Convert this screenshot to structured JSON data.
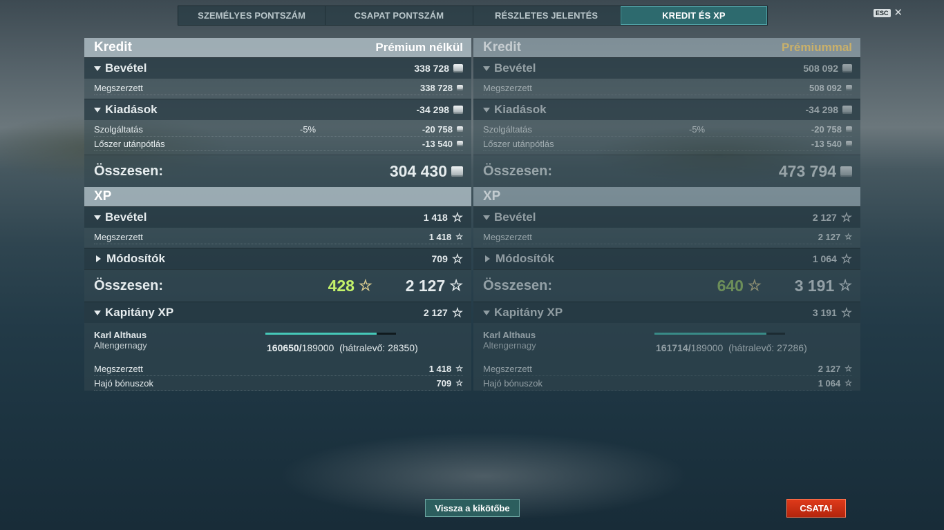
{
  "tabs": [
    "SZEMÉLYES PONTSZÁM",
    "CSAPAT PONTSZÁM",
    "RÉSZLETES JELENTÉS",
    "KREDIT ÉS XP"
  ],
  "esc_label": "ESC",
  "left": {
    "credit_title": "Kredit",
    "credit_mode": "Prémium nélkül",
    "income_label": "Bevétel",
    "income_value": "338 728",
    "earned_label": "Megszerzett",
    "earned_value": "338 728",
    "expenses_label": "Kiadások",
    "expenses_value": "-34 298",
    "service_label": "Szolgáltatás",
    "service_pct": "-5%",
    "service_value": "-20 758",
    "ammo_label": "Lőszer utánpótlás",
    "ammo_value": "-13 540",
    "total_label": "Összesen:",
    "credit_total": "304 430",
    "xp_title": "XP",
    "xp_income_label": "Bevétel",
    "xp_income_value": "1 418",
    "xp_earned_label": "Megszerzett",
    "xp_earned_value": "1 418",
    "modifiers_label": "Módosítók",
    "modifiers_value": "709",
    "xp_bonus": "428",
    "xp_total": "2 127",
    "captain_label": "Kapitány XP",
    "captain_value": "2 127",
    "captain_name": "Karl Althaus",
    "captain_rank": "Altengernagy",
    "progress_current": "160650/",
    "progress_max": "189000",
    "progress_remaining": "(hátralevő: 28350)",
    "progress_fraction": 0.85,
    "cap_earned_label": "Megszerzett",
    "cap_earned_value": "1 418",
    "ship_bonus_label": "Hajó bónuszok",
    "ship_bonus_value": "709"
  },
  "right": {
    "credit_title": "Kredit",
    "credit_mode": "Prémiummal",
    "income_label": "Bevétel",
    "income_value": "508 092",
    "earned_label": "Megszerzett",
    "earned_value": "508 092",
    "expenses_label": "Kiadások",
    "expenses_value": "-34 298",
    "service_label": "Szolgáltatás",
    "service_pct": "-5%",
    "service_value": "-20 758",
    "ammo_label": "Lőszer utánpótlás",
    "ammo_value": "-13 540",
    "total_label": "Összesen:",
    "credit_total": "473 794",
    "xp_title": "XP",
    "xp_income_label": "Bevétel",
    "xp_income_value": "2 127",
    "xp_earned_label": "Megszerzett",
    "xp_earned_value": "2 127",
    "modifiers_label": "Módosítók",
    "modifiers_value": "1 064",
    "xp_bonus": "640",
    "xp_total": "3 191",
    "captain_label": "Kapitány XP",
    "captain_value": "3 191",
    "captain_name": "Karl Althaus",
    "captain_rank": "Altengernagy",
    "progress_current": "161714/",
    "progress_max": "189000",
    "progress_remaining": "(hátralevő: 27286)",
    "progress_fraction": 0.856,
    "cap_earned_label": "Megszerzett",
    "cap_earned_value": "2 127",
    "ship_bonus_label": "Hajó bónuszok",
    "ship_bonus_value": "1 064"
  },
  "buttons": {
    "back": "Vissza a kikötőbe",
    "battle": "CSATA!"
  }
}
